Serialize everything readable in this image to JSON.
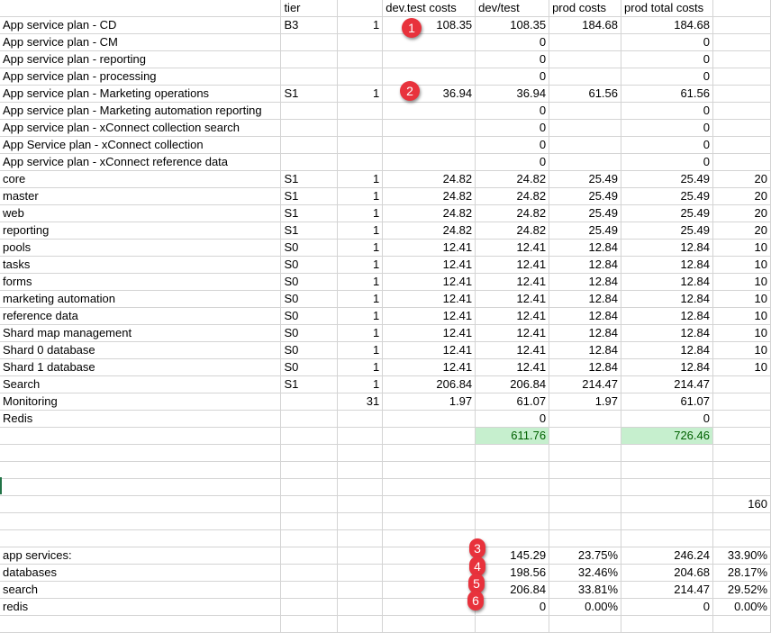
{
  "headers": [
    "",
    "tier",
    "",
    "dev.test costs",
    "dev/test",
    "prod costs",
    "prod total costs",
    ""
  ],
  "rows": [
    [
      "App service plan - CD",
      "B3",
      "1",
      "108.35",
      "108.35",
      "184.68",
      "184.68",
      ""
    ],
    [
      "App service plan - CM",
      "",
      "",
      "",
      "0",
      "",
      "0",
      ""
    ],
    [
      "App service plan - reporting",
      "",
      "",
      "",
      "0",
      "",
      "0",
      ""
    ],
    [
      "App service plan - processing",
      "",
      "",
      "",
      "0",
      "",
      "0",
      ""
    ],
    [
      "App service plan - Marketing operations",
      "S1",
      "1",
      "36.94",
      "36.94",
      "61.56",
      "61.56",
      ""
    ],
    [
      "App service plan - Marketing automation reporting",
      "",
      "",
      "",
      "0",
      "",
      "0",
      ""
    ],
    [
      "App service plan - xConnect collection search",
      "",
      "",
      "",
      "0",
      "",
      "0",
      ""
    ],
    [
      "App Service plan - xConnect collection",
      "",
      "",
      "",
      "0",
      "",
      "0",
      ""
    ],
    [
      "App service plan - xConnect reference data",
      "",
      "",
      "",
      "0",
      "",
      "0",
      ""
    ],
    [
      "core",
      "S1",
      "1",
      "24.82",
      "24.82",
      "25.49",
      "25.49",
      "20"
    ],
    [
      "master",
      "S1",
      "1",
      "24.82",
      "24.82",
      "25.49",
      "25.49",
      "20"
    ],
    [
      "web",
      "S1",
      "1",
      "24.82",
      "24.82",
      "25.49",
      "25.49",
      "20"
    ],
    [
      "reporting",
      "S1",
      "1",
      "24.82",
      "24.82",
      "25.49",
      "25.49",
      "20"
    ],
    [
      "pools",
      "S0",
      "1",
      "12.41",
      "12.41",
      "12.84",
      "12.84",
      "10"
    ],
    [
      "tasks",
      "S0",
      "1",
      "12.41",
      "12.41",
      "12.84",
      "12.84",
      "10"
    ],
    [
      "forms",
      "S0",
      "1",
      "12.41",
      "12.41",
      "12.84",
      "12.84",
      "10"
    ],
    [
      "marketing automation",
      "S0",
      "1",
      "12.41",
      "12.41",
      "12.84",
      "12.84",
      "10"
    ],
    [
      "reference data",
      "S0",
      "1",
      "12.41",
      "12.41",
      "12.84",
      "12.84",
      "10"
    ],
    [
      "Shard map management",
      "S0",
      "1",
      "12.41",
      "12.41",
      "12.84",
      "12.84",
      "10"
    ],
    [
      "Shard 0 database",
      "S0",
      "1",
      "12.41",
      "12.41",
      "12.84",
      "12.84",
      "10"
    ],
    [
      "Shard 1 database",
      "S0",
      "1",
      "12.41",
      "12.41",
      "12.84",
      "12.84",
      "10"
    ],
    [
      "Search",
      "S1",
      "1",
      "206.84",
      "206.84",
      "214.47",
      "214.47",
      ""
    ],
    [
      "Monitoring",
      "",
      "31",
      "1.97",
      "61.07",
      "1.97",
      "61.07",
      ""
    ],
    [
      "Redis",
      "",
      "",
      "",
      "0",
      "",
      "0",
      ""
    ],
    [
      "",
      "",
      "",
      "",
      "611.76",
      "",
      "726.46",
      ""
    ],
    [
      "",
      "",
      "",
      "",
      "",
      "",
      "",
      ""
    ],
    [
      "",
      "",
      "",
      "",
      "",
      "",
      "",
      ""
    ],
    [
      "",
      "",
      "",
      "",
      "",
      "",
      "",
      ""
    ],
    [
      "",
      "",
      "",
      "",
      "",
      "",
      "",
      "160"
    ],
    [
      "",
      "",
      "",
      "",
      "",
      "",
      "",
      ""
    ],
    [
      "",
      "",
      "",
      "",
      "",
      "",
      "",
      ""
    ],
    [
      "app services:",
      "",
      "",
      "",
      "145.29",
      "23.75%",
      "246.24",
      "33.90%"
    ],
    [
      "databases",
      "",
      "",
      "",
      "198.56",
      "32.46%",
      "204.68",
      "28.17%"
    ],
    [
      "search",
      "",
      "",
      "",
      "206.84",
      "33.81%",
      "214.47",
      "29.52%"
    ],
    [
      "redis",
      "",
      "",
      "",
      "0",
      "0.00%",
      "0",
      "0.00%"
    ],
    [
      "",
      "",
      "",
      "",
      "",
      "",
      "",
      ""
    ]
  ],
  "highlight_row": 24,
  "highlight_color": "#c6efce",
  "badges": [
    "1",
    "2",
    "3",
    "4",
    "5",
    "6"
  ],
  "badge_color": "#e8323c"
}
